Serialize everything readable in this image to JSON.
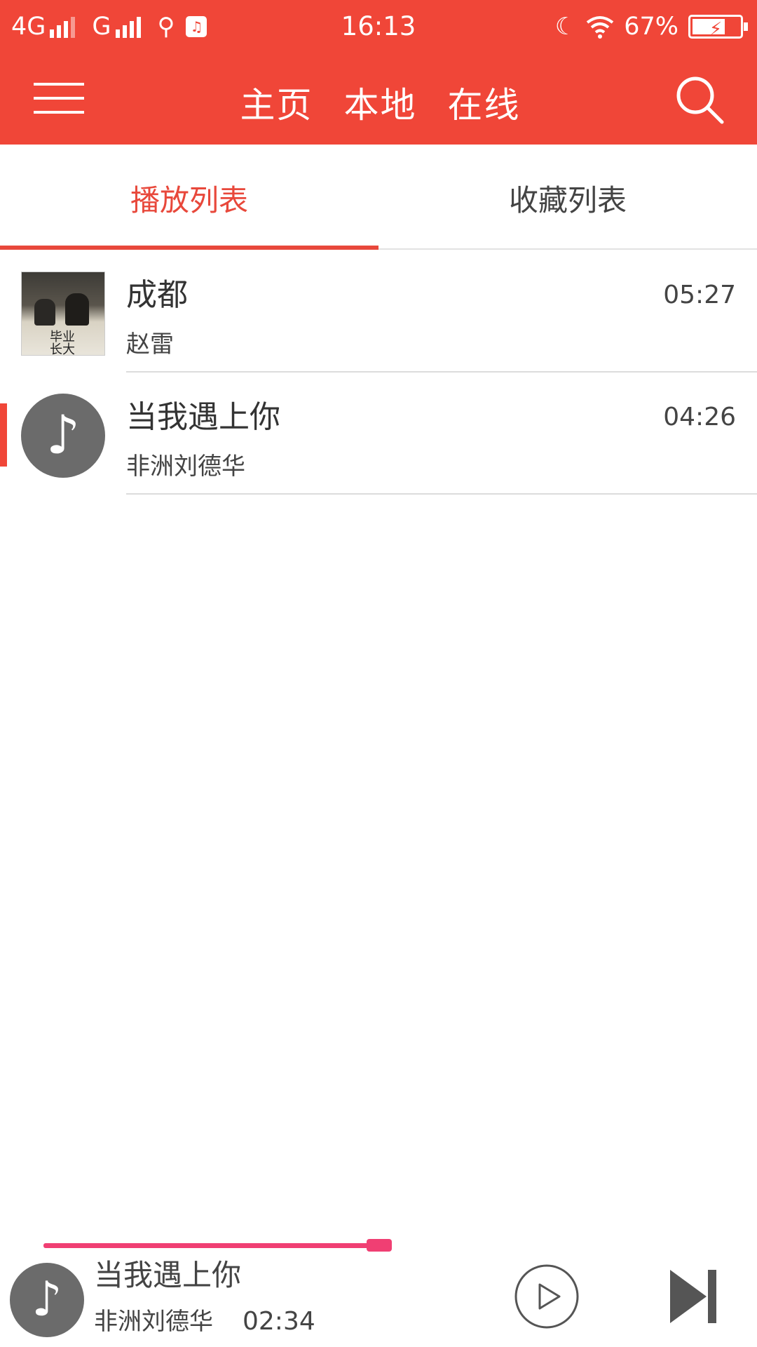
{
  "status_bar": {
    "network1": "4G",
    "network2": "G",
    "time": "16:13",
    "battery": "67%"
  },
  "app_bar": {
    "tabs": [
      "主页",
      "本地",
      "在线"
    ]
  },
  "list_tabs": {
    "play_list": "播放列表",
    "favorites": "收藏列表"
  },
  "songs": [
    {
      "title": "成都",
      "artist": "赵雷",
      "duration": "05:27"
    },
    {
      "title": "当我遇上你",
      "artist": "非洲刘德华",
      "duration": "04:26"
    }
  ],
  "player": {
    "title": "当我遇上你",
    "artist": "非洲刘德华",
    "elapsed": "02:34",
    "progress_percent": 52,
    "accent_color": "#f03f73"
  },
  "colors": {
    "primary": "#f04638",
    "active_tab": "#e8483b"
  },
  "cover_art_text": "毕业 长大"
}
